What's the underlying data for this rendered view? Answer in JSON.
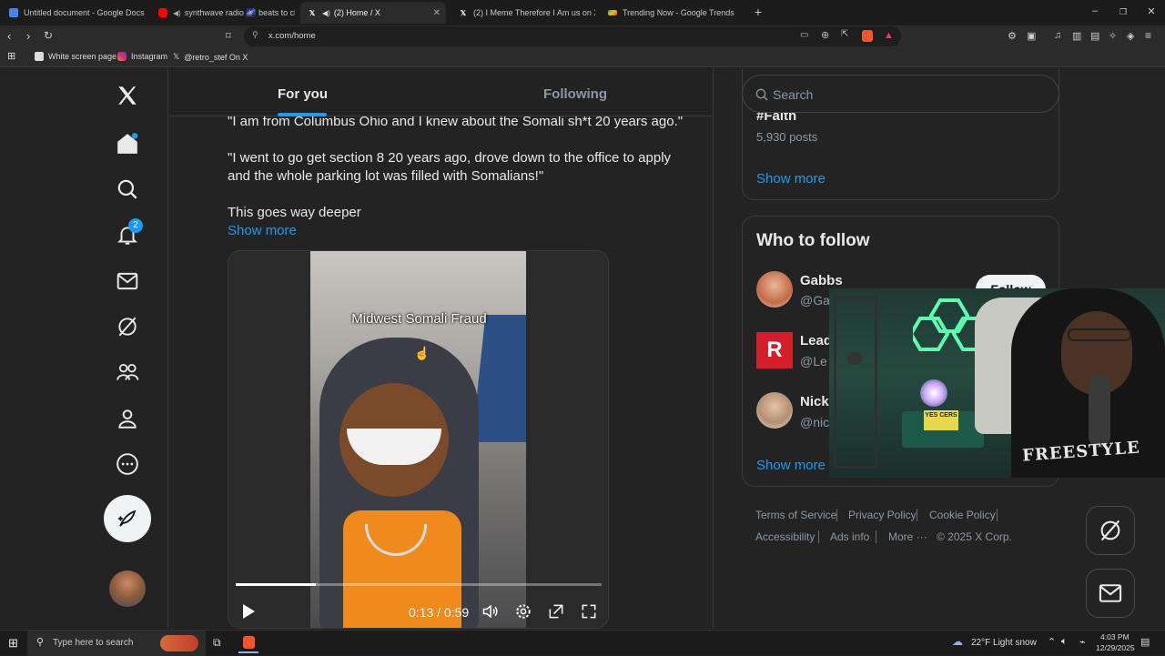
{
  "browser": {
    "tabs": [
      {
        "label": "Untitled document - Google Docs",
        "icon": "docs-icon",
        "color": "#4285f4"
      },
      {
        "label": "synthwave radio 🌌 beats to chill",
        "icon": "youtube-icon",
        "color": "#ff0000"
      },
      {
        "label": "(2) Home / X",
        "icon": "x-icon",
        "color": "#ffffff"
      },
      {
        "label": "(2) I Meme Therefore I Am us on X: \"",
        "icon": "x-icon",
        "color": "#ffffff"
      },
      {
        "label": "Trending Now - Google Trends",
        "icon": "trends-icon",
        "color": "#34a853"
      }
    ],
    "url": "x.com/home",
    "bookmarks": [
      "White screen page",
      "Instagram",
      "@retro_stef On X"
    ]
  },
  "nav": {
    "notifications_badge": "2"
  },
  "feed": {
    "tabs": [
      "For you",
      "Following"
    ],
    "tweet_lines": [
      "\"I am from Columbus Ohio and I knew about the Somali sh*t 20 years ago.\"",
      "\"I went to go get section 8 20 years ago, drove down to the office to apply",
      "and the whole parking lot was filled with Somalians!\"",
      "This goes way deeper"
    ],
    "show_more": "Show more",
    "video": {
      "caption": "Midwest Somali Fraud",
      "time": "0:13 / 0:59",
      "progress": 0.22
    }
  },
  "sidebar": {
    "search_placeholder": "Search",
    "trend_cut_title": "#Faith",
    "trend_posts": "5,930 posts",
    "show_more": "Show more",
    "who_to_follow": {
      "title": "Who to follow",
      "accounts": [
        {
          "name": "Gabbs",
          "handle": "@Ga"
        },
        {
          "name": "Lead",
          "handle": "@Le"
        },
        {
          "name": "Nick",
          "handle": "@nic"
        }
      ],
      "follow_label": "Follow",
      "show_more": "Show more"
    },
    "footer": [
      "Terms of Service",
      "Privacy Policy",
      "Cookie Policy",
      "Accessibility",
      "Ads info",
      "More ···",
      "© 2025 X Corp."
    ]
  },
  "webcam": {
    "sign_text": "YES CERS",
    "shirt_text": "FREESTYLE"
  },
  "taskbar": {
    "search_placeholder": "Type here to search",
    "weather": "22°F  Light snow",
    "time": "4:03 PM",
    "date": "12/29/2025"
  }
}
